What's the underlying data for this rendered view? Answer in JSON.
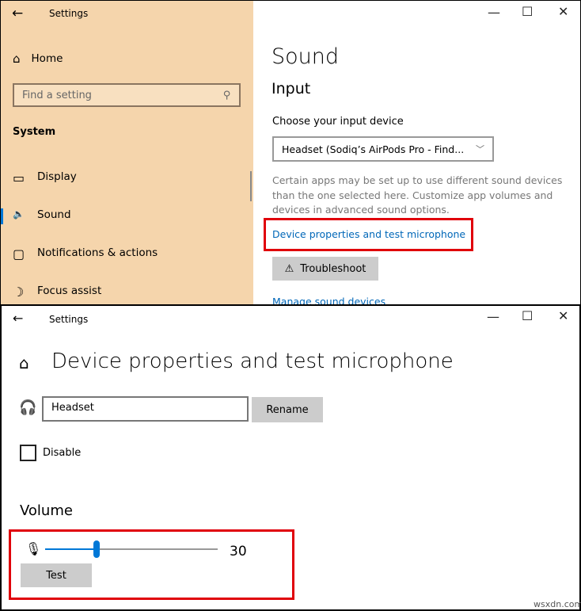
{
  "top_window": {
    "title": "Settings",
    "sidebar": {
      "home": "Home",
      "search_placeholder": "Find a setting",
      "section": "System",
      "items": [
        {
          "label": "Display",
          "icon": "monitor-icon"
        },
        {
          "label": "Sound",
          "icon": "speaker-icon",
          "selected": true
        },
        {
          "label": "Notifications & actions",
          "icon": "notification-icon"
        },
        {
          "label": "Focus assist",
          "icon": "moon-icon"
        }
      ]
    },
    "main": {
      "title": "Sound",
      "section": "Input",
      "choose_label": "Choose your input device",
      "device_value": "Headset (Sodiq’s AirPods Pro - Find...",
      "info": "Certain apps may be set up to use different sound devices than the one selected here. Customize app volumes and devices in advanced sound options.",
      "link_properties": "Device properties and test microphone",
      "troubleshoot": "Troubleshoot",
      "link_manage": "Manage sound devices"
    }
  },
  "bottom_window": {
    "title": "Settings",
    "page_title": "Device properties and test microphone",
    "name_value": "Headset",
    "rename": "Rename",
    "disable": "Disable",
    "disable_checked": false,
    "volume_label": "Volume",
    "volume_value": "30",
    "volume_fraction": 0.3,
    "test": "Test"
  },
  "colors": {
    "sidebar_bg": "#f5d5ac",
    "link": "#0067b8",
    "highlight": "#e0000a",
    "accent": "#0078d7"
  },
  "watermark": "wsxdn.com"
}
